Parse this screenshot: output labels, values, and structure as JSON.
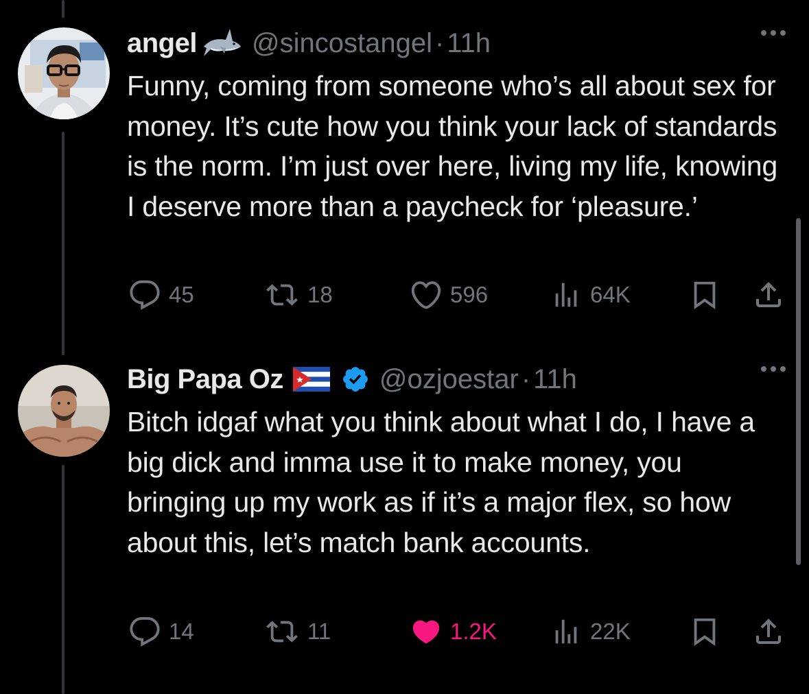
{
  "tweets": [
    {
      "name": "angel",
      "name_emoji": "shark",
      "handle": "@sincostangel",
      "dot": "·",
      "time": "11h",
      "text": "Funny, coming from someone who’s all about sex for money. It’s cute how you think your lack of standards is the norm. I’m just over here, living my life, knowing I deserve more than a paycheck for ‘pleasure.’",
      "replies": "45",
      "reposts": "18",
      "likes": "596",
      "views": "64K",
      "liked": false
    },
    {
      "name": "Big Papa Oz",
      "name_emoji": "cuba-flag",
      "verified": true,
      "handle": "@ozjoestar",
      "dot": "·",
      "time": "11h",
      "text": "Bitch idgaf what you think about what I do, I have a big dick and imma use it to make money, you bringing up my work as if it’s a major flex, so how about this, let’s match bank accounts.",
      "replies": "14",
      "reposts": "11",
      "likes": "1.2K",
      "views": "22K",
      "liked": true
    }
  ],
  "colors": {
    "background": "#000000",
    "text": "#e7e9ea",
    "muted": "#71767b",
    "like": "#f91880",
    "verified": "#1d9bf0"
  }
}
